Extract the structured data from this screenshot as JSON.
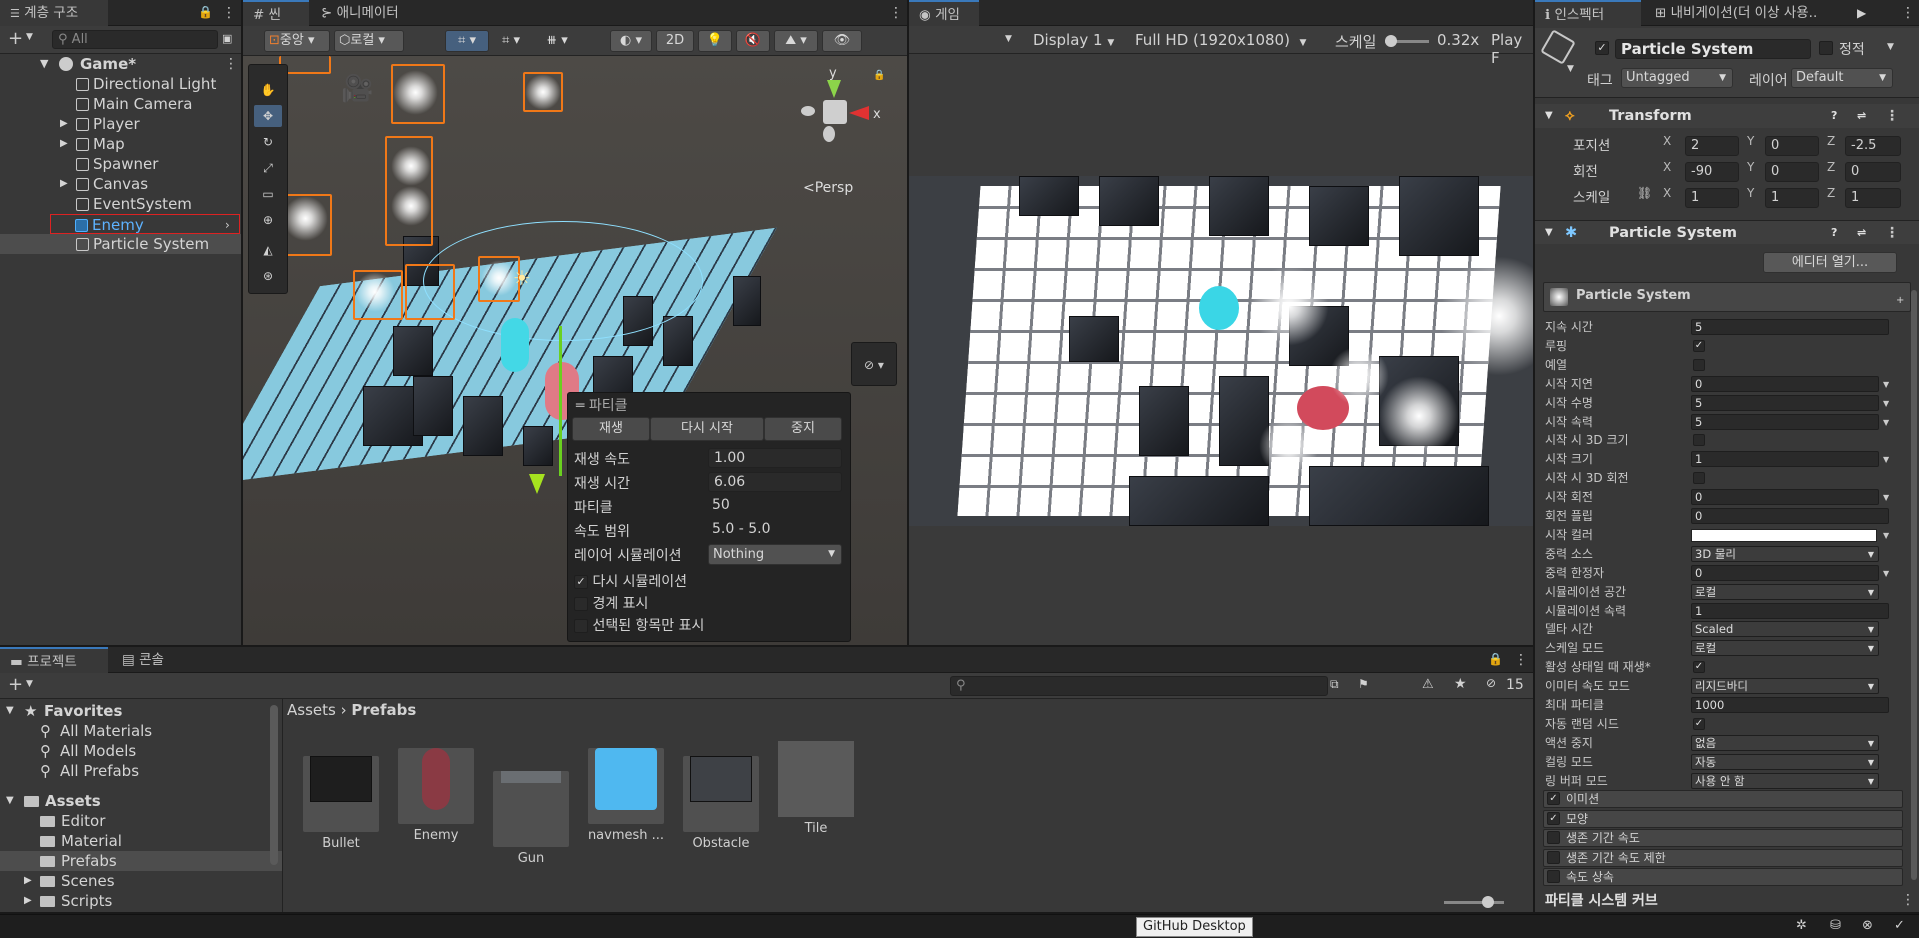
{
  "hierarchy": {
    "tab_label": "계층 구조",
    "search_placeholder": "All",
    "root": "Game*",
    "items": [
      {
        "label": "Directional Light",
        "expandable": false
      },
      {
        "label": "Main Camera",
        "expandable": false
      },
      {
        "label": "Player",
        "expandable": true
      },
      {
        "label": "Map",
        "expandable": true
      },
      {
        "label": "Spawner",
        "expandable": false
      },
      {
        "label": "Canvas",
        "expandable": true
      },
      {
        "label": "EventSystem",
        "expandable": false
      },
      {
        "label": "Enemy",
        "expandable": false,
        "prefab": true
      },
      {
        "label": "Particle System",
        "expandable": false,
        "selected": true
      }
    ]
  },
  "scene": {
    "tab_label": "씬",
    "animator_tab_label": "애니메이터",
    "pivot_label": "중앙",
    "space_label": "로컬",
    "mode_2d_label": "2D",
    "persp_label": "<Persp",
    "particle_overlay": {
      "title": "파티클",
      "play_label": "재생",
      "restart_label": "다시 시작",
      "stop_label": "중지",
      "rows": [
        {
          "label": "재생 속도",
          "value": "1.00"
        },
        {
          "label": "재생 시간",
          "value": "6.06"
        },
        {
          "label": "파티클",
          "value": "50"
        },
        {
          "label": "속도 범위",
          "value": "5.0 - 5.0"
        }
      ],
      "layer_sim_label": "레이어 시뮬레이션",
      "layer_sim_value": "Nothing",
      "checks": [
        {
          "label": "다시 시뮬레이션",
          "checked": true
        },
        {
          "label": "경계 표시",
          "checked": false
        },
        {
          "label": "선택된 항목만 표시",
          "checked": false
        }
      ]
    }
  },
  "game": {
    "tab_label": "게임",
    "display_label": "Display 1",
    "resolution_label": "Full HD (1920x1080)",
    "scale_label": "스케일",
    "scale_value": "0.32x",
    "play_focus_label": "Play F"
  },
  "inspector": {
    "tab_label": "인스펙터",
    "nav_tab_label": "내비게이션(더 이상 사용..",
    "object_name": "Particle System",
    "static_label": "정적",
    "tag_label": "태그",
    "tag_value": "Untagged",
    "layer_label": "레이어",
    "layer_value": "Default",
    "transform": {
      "title": "Transform",
      "rows": [
        {
          "label": "포지션",
          "x": "2",
          "y": "0",
          "z": "-2.5"
        },
        {
          "label": "회전",
          "x": "-90",
          "y": "0",
          "z": "0"
        },
        {
          "label": "스케일",
          "x": "1",
          "y": "1",
          "z": "1"
        }
      ]
    },
    "particle_system": {
      "title": "Particle System",
      "open_editor_label": "에디터 열기...",
      "module_title": "Particle System",
      "props": [
        {
          "label": "지속 시간",
          "value": "5",
          "type": "text"
        },
        {
          "label": "루핑",
          "value": "✓",
          "type": "check"
        },
        {
          "label": "예열",
          "value": "",
          "type": "check"
        },
        {
          "label": "시작 지연",
          "value": "0",
          "type": "text-dd"
        },
        {
          "label": "시작 수명",
          "value": "5",
          "type": "text-dd"
        },
        {
          "label": "시작 속력",
          "value": "5",
          "type": "text-dd"
        },
        {
          "label": "시작 시 3D 크기",
          "value": "",
          "type": "check"
        },
        {
          "label": "시작 크기",
          "value": "1",
          "type": "text-dd"
        },
        {
          "label": "시작 시 3D 회전",
          "value": "",
          "type": "check"
        },
        {
          "label": "시작 회전",
          "value": "0",
          "type": "text-dd"
        },
        {
          "label": "회전 플립",
          "value": "0",
          "type": "text"
        },
        {
          "label": "시작 컬러",
          "value": "",
          "type": "color"
        },
        {
          "label": "중력 소스",
          "value": "3D 물리",
          "type": "select"
        },
        {
          "label": "중력 한정자",
          "value": "0",
          "type": "text-dd"
        },
        {
          "label": "시뮬레이션 공간",
          "value": "로컬",
          "type": "select"
        },
        {
          "label": "시뮬레이션 속력",
          "value": "1",
          "type": "text"
        },
        {
          "label": "델타 시간",
          "value": "Scaled",
          "type": "select"
        },
        {
          "label": "스케일 모드",
          "value": "로컬",
          "type": "select"
        },
        {
          "label": "활성 상태일 때 재생*",
          "value": "✓",
          "type": "check"
        },
        {
          "label": "이미터 속도 모드",
          "value": "리지드바디",
          "type": "select"
        },
        {
          "label": "최대 파티클",
          "value": "1000",
          "type": "text"
        },
        {
          "label": "자동 랜덤 시드",
          "value": "✓",
          "type": "check"
        },
        {
          "label": "액션 중지",
          "value": "없음",
          "type": "select"
        },
        {
          "label": "컬링 모드",
          "value": "자동",
          "type": "select"
        },
        {
          "label": "링 버퍼 모드",
          "value": "사용 안 함",
          "type": "select"
        }
      ],
      "modules": [
        {
          "label": "이미션",
          "checked": true
        },
        {
          "label": "모양",
          "checked": true
        },
        {
          "label": "생존 기간 속도",
          "checked": false
        },
        {
          "label": "생존 기간 속도 제한",
          "checked": false
        },
        {
          "label": "속도 상속",
          "checked": false
        }
      ],
      "curves_label": "파티클 시스템 커브"
    }
  },
  "project": {
    "tab_label": "프로젝트",
    "console_tab_label": "콘솔",
    "hidden_count": "15",
    "favorites_label": "Favorites",
    "favorites": [
      "All Materials",
      "All Models",
      "All Prefabs"
    ],
    "assets_label": "Assets",
    "folders": [
      {
        "label": "Editor",
        "expandable": false
      },
      {
        "label": "Material",
        "expandable": false
      },
      {
        "label": "Prefabs",
        "expandable": false,
        "selected": true
      },
      {
        "label": "Scenes",
        "expandable": true
      },
      {
        "label": "Scripts",
        "expandable": true
      }
    ],
    "breadcrumb_root": "Assets",
    "breadcrumb_current": "Prefabs",
    "assets": [
      {
        "label": "Bullet",
        "color": "#1e1e1e"
      },
      {
        "label": "Enemy",
        "color": "#8a3a44"
      },
      {
        "label": "Gun",
        "color": "#6a6e72"
      },
      {
        "label": "navmesh ...",
        "color": "#4fb8f0"
      },
      {
        "label": "Obstacle",
        "color": "#3e4146"
      },
      {
        "label": "Tile",
        "color": "#5a5a5a"
      }
    ]
  },
  "status": {
    "tooltip": "GitHub Desktop"
  },
  "colors": {
    "accent": "#3a79bb",
    "selection": "#2c5d87",
    "gizmo_orange": "#f07818"
  }
}
